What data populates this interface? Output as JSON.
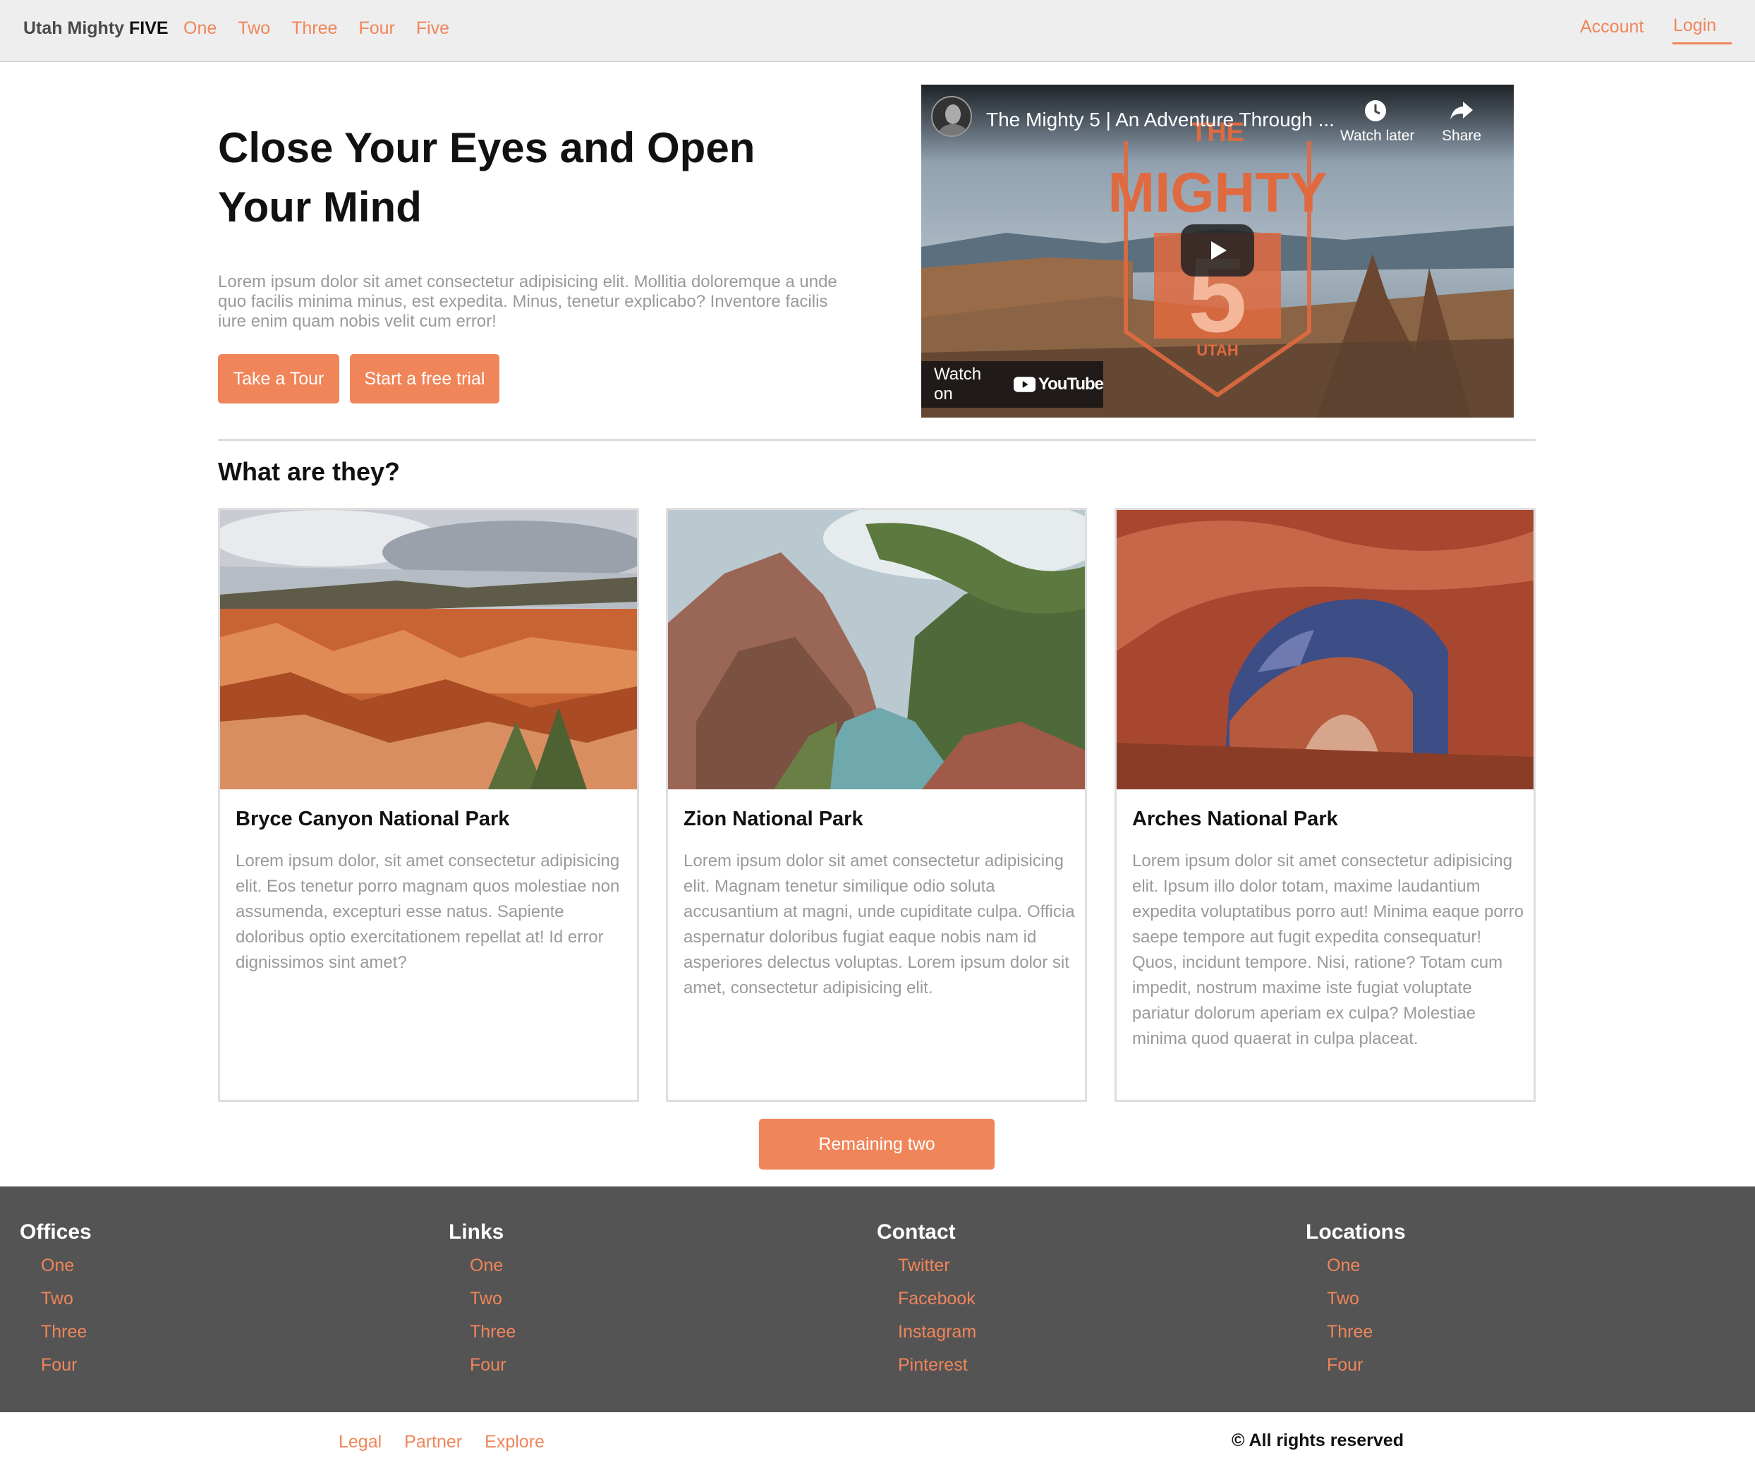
{
  "nav": {
    "brand_prefix": "Utah Mighty",
    "brand_bold": "FIVE",
    "links": [
      "One",
      "Two",
      "Three",
      "Four",
      "Five"
    ],
    "account": "Account",
    "login": "Login"
  },
  "hero": {
    "title": "Close Your Eyes and Open Your Mind",
    "text": "Lorem ipsum dolor sit amet consectetur adipisicing elit. Mollitia doloremque a unde quo facilis minima minus, est expedita. Minus, tenetur explicabo? Inventore facilis iure enim quam nobis velit cum error!",
    "tour_button": "Take a Tour",
    "trial_button": "Start a free trial"
  },
  "video": {
    "title": "The Mighty 5 | An Adventure Through ...",
    "watch_later": "Watch later",
    "share": "Share",
    "watch_on": "Watch on",
    "youtube": "YouTube",
    "logo_top": "THE",
    "logo_main": "MIGHTY",
    "logo_number": "5",
    "logo_bottom": "UTAH"
  },
  "section": {
    "title": "What are they?",
    "remaining_button": "Remaining two"
  },
  "cards": [
    {
      "title": "Bryce Canyon National Park",
      "text": "Lorem ipsum dolor, sit amet consectetur adipisicing elit. Eos tenetur porro magnam quos molestiae non assumenda, excepturi esse natus. Sapiente doloribus optio exercitationem repellat at! Id error dignissimos sint amet?"
    },
    {
      "title": "Zion National Park",
      "text": "Lorem ipsum dolor sit amet consectetur adipisicing elit. Magnam tenetur similique odio soluta accusantium at magni, unde cupiditate culpa. Officia aspernatur doloribus fugiat eaque nobis nam id asperiores delectus voluptas. Lorem ipsum dolor sit amet, consectetur adipisicing elit."
    },
    {
      "title": "Arches National Park",
      "text": "Lorem ipsum dolor sit amet consectetur adipisicing elit. Ipsum illo dolor totam, maxime laudantium expedita voluptatibus porro aut! Minima eaque porro saepe tempore aut fugit expedita consequatur! Quos, incidunt tempore. Nisi, ratione? Totam cum impedit, nostrum maxime iste fugiat voluptate pariatur dolorum aperiam ex culpa? Molestiae minima quod quaerat in culpa placeat."
    }
  ],
  "footer": {
    "columns": [
      {
        "title": "Offices",
        "items": [
          "One",
          "Two",
          "Three",
          "Four"
        ]
      },
      {
        "title": "Links",
        "items": [
          "One",
          "Two",
          "Three",
          "Four"
        ]
      },
      {
        "title": "Contact",
        "items": [
          "Twitter",
          "Facebook",
          "Instagram",
          "Pinterest"
        ]
      },
      {
        "title": "Locations",
        "items": [
          "One",
          "Two",
          "Three",
          "Four"
        ]
      }
    ],
    "bottom_links": [
      "Legal",
      "Partner",
      "Explore"
    ],
    "rights": "© All rights reserved"
  },
  "colors": {
    "accent": "#f0855a",
    "footer_bg": "#545454",
    "nav_bg": "#eeeeee"
  }
}
